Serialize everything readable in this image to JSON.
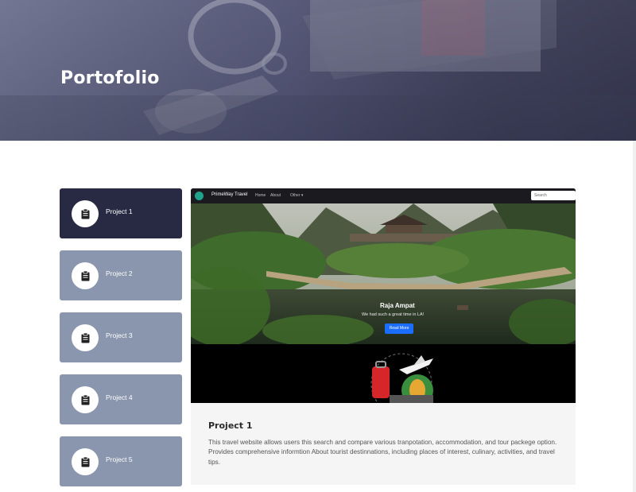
{
  "hero": {
    "title": "Portofolio"
  },
  "sidebar": {
    "items": [
      {
        "label": "Project 1",
        "icon": "clipboard-icon",
        "active": true
      },
      {
        "label": "Project 2",
        "icon": "clipboard-icon",
        "active": false
      },
      {
        "label": "Project 3",
        "icon": "clipboard-icon",
        "active": false
      },
      {
        "label": "Project 4",
        "icon": "clipboard-icon",
        "active": false
      },
      {
        "label": "Project 5",
        "icon": "clipboard-icon",
        "active": false
      }
    ]
  },
  "preview": {
    "brand": "PrimeWay Travel",
    "nav_links": [
      "Home",
      "About",
      "Other ▾"
    ],
    "search_placeholder": "Search",
    "caption_title": "Raja Ampat",
    "caption_subtitle": "We had such a great time in LA!",
    "caption_button": "Read More"
  },
  "detail": {
    "title": "Project 1",
    "description": "This travel website allows users this search and compare various tranpotation, accommodation, and tour packege option. Provides comprehensive informtion About tourist destinnations, including places of interest, culinary, activities, and travel tips."
  },
  "colors": {
    "active_item": "#282a44",
    "inactive_item": "#8a96ad",
    "hero_overlay": "#4f5272",
    "detail_bg": "#f5f5f5"
  }
}
